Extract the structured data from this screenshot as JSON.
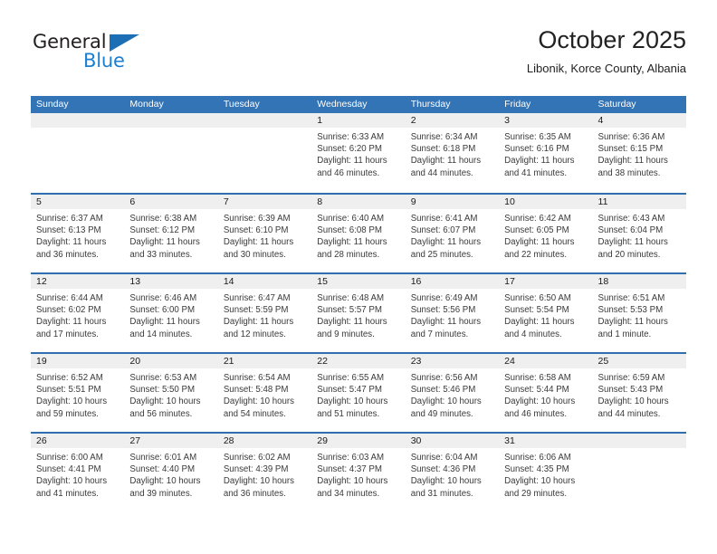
{
  "brand": {
    "name_top": "General",
    "name_bottom": "Blue",
    "triangle_color": "#1c6fb5",
    "blue_color": "#1c7fd0"
  },
  "header": {
    "title": "October 2025",
    "subtitle": "Libonik, Korce County, Albania"
  },
  "theme": {
    "header_blue": "#3274b6",
    "row_divider_blue": "#2f6fb0",
    "day_band_gray": "#efefef"
  },
  "weekdays": [
    "Sunday",
    "Monday",
    "Tuesday",
    "Wednesday",
    "Thursday",
    "Friday",
    "Saturday"
  ],
  "labels": {
    "sunrise": "Sunrise:",
    "sunset": "Sunset:",
    "daylight": "Daylight:"
  },
  "weeks": [
    [
      {
        "empty": true
      },
      {
        "empty": true
      },
      {
        "empty": true
      },
      {
        "day": "1",
        "sunrise": "Sunrise: 6:33 AM",
        "sunset": "Sunset: 6:20 PM",
        "daylight1": "Daylight: 11 hours",
        "daylight2": "and 46 minutes."
      },
      {
        "day": "2",
        "sunrise": "Sunrise: 6:34 AM",
        "sunset": "Sunset: 6:18 PM",
        "daylight1": "Daylight: 11 hours",
        "daylight2": "and 44 minutes."
      },
      {
        "day": "3",
        "sunrise": "Sunrise: 6:35 AM",
        "sunset": "Sunset: 6:16 PM",
        "daylight1": "Daylight: 11 hours",
        "daylight2": "and 41 minutes."
      },
      {
        "day": "4",
        "sunrise": "Sunrise: 6:36 AM",
        "sunset": "Sunset: 6:15 PM",
        "daylight1": "Daylight: 11 hours",
        "daylight2": "and 38 minutes."
      }
    ],
    [
      {
        "day": "5",
        "sunrise": "Sunrise: 6:37 AM",
        "sunset": "Sunset: 6:13 PM",
        "daylight1": "Daylight: 11 hours",
        "daylight2": "and 36 minutes."
      },
      {
        "day": "6",
        "sunrise": "Sunrise: 6:38 AM",
        "sunset": "Sunset: 6:12 PM",
        "daylight1": "Daylight: 11 hours",
        "daylight2": "and 33 minutes."
      },
      {
        "day": "7",
        "sunrise": "Sunrise: 6:39 AM",
        "sunset": "Sunset: 6:10 PM",
        "daylight1": "Daylight: 11 hours",
        "daylight2": "and 30 minutes."
      },
      {
        "day": "8",
        "sunrise": "Sunrise: 6:40 AM",
        "sunset": "Sunset: 6:08 PM",
        "daylight1": "Daylight: 11 hours",
        "daylight2": "and 28 minutes."
      },
      {
        "day": "9",
        "sunrise": "Sunrise: 6:41 AM",
        "sunset": "Sunset: 6:07 PM",
        "daylight1": "Daylight: 11 hours",
        "daylight2": "and 25 minutes."
      },
      {
        "day": "10",
        "sunrise": "Sunrise: 6:42 AM",
        "sunset": "Sunset: 6:05 PM",
        "daylight1": "Daylight: 11 hours",
        "daylight2": "and 22 minutes."
      },
      {
        "day": "11",
        "sunrise": "Sunrise: 6:43 AM",
        "sunset": "Sunset: 6:04 PM",
        "daylight1": "Daylight: 11 hours",
        "daylight2": "and 20 minutes."
      }
    ],
    [
      {
        "day": "12",
        "sunrise": "Sunrise: 6:44 AM",
        "sunset": "Sunset: 6:02 PM",
        "daylight1": "Daylight: 11 hours",
        "daylight2": "and 17 minutes."
      },
      {
        "day": "13",
        "sunrise": "Sunrise: 6:46 AM",
        "sunset": "Sunset: 6:00 PM",
        "daylight1": "Daylight: 11 hours",
        "daylight2": "and 14 minutes."
      },
      {
        "day": "14",
        "sunrise": "Sunrise: 6:47 AM",
        "sunset": "Sunset: 5:59 PM",
        "daylight1": "Daylight: 11 hours",
        "daylight2": "and 12 minutes."
      },
      {
        "day": "15",
        "sunrise": "Sunrise: 6:48 AM",
        "sunset": "Sunset: 5:57 PM",
        "daylight1": "Daylight: 11 hours",
        "daylight2": "and 9 minutes."
      },
      {
        "day": "16",
        "sunrise": "Sunrise: 6:49 AM",
        "sunset": "Sunset: 5:56 PM",
        "daylight1": "Daylight: 11 hours",
        "daylight2": "and 7 minutes."
      },
      {
        "day": "17",
        "sunrise": "Sunrise: 6:50 AM",
        "sunset": "Sunset: 5:54 PM",
        "daylight1": "Daylight: 11 hours",
        "daylight2": "and 4 minutes."
      },
      {
        "day": "18",
        "sunrise": "Sunrise: 6:51 AM",
        "sunset": "Sunset: 5:53 PM",
        "daylight1": "Daylight: 11 hours",
        "daylight2": "and 1 minute."
      }
    ],
    [
      {
        "day": "19",
        "sunrise": "Sunrise: 6:52 AM",
        "sunset": "Sunset: 5:51 PM",
        "daylight1": "Daylight: 10 hours",
        "daylight2": "and 59 minutes."
      },
      {
        "day": "20",
        "sunrise": "Sunrise: 6:53 AM",
        "sunset": "Sunset: 5:50 PM",
        "daylight1": "Daylight: 10 hours",
        "daylight2": "and 56 minutes."
      },
      {
        "day": "21",
        "sunrise": "Sunrise: 6:54 AM",
        "sunset": "Sunset: 5:48 PM",
        "daylight1": "Daylight: 10 hours",
        "daylight2": "and 54 minutes."
      },
      {
        "day": "22",
        "sunrise": "Sunrise: 6:55 AM",
        "sunset": "Sunset: 5:47 PM",
        "daylight1": "Daylight: 10 hours",
        "daylight2": "and 51 minutes."
      },
      {
        "day": "23",
        "sunrise": "Sunrise: 6:56 AM",
        "sunset": "Sunset: 5:46 PM",
        "daylight1": "Daylight: 10 hours",
        "daylight2": "and 49 minutes."
      },
      {
        "day": "24",
        "sunrise": "Sunrise: 6:58 AM",
        "sunset": "Sunset: 5:44 PM",
        "daylight1": "Daylight: 10 hours",
        "daylight2": "and 46 minutes."
      },
      {
        "day": "25",
        "sunrise": "Sunrise: 6:59 AM",
        "sunset": "Sunset: 5:43 PM",
        "daylight1": "Daylight: 10 hours",
        "daylight2": "and 44 minutes."
      }
    ],
    [
      {
        "day": "26",
        "sunrise": "Sunrise: 6:00 AM",
        "sunset": "Sunset: 4:41 PM",
        "daylight1": "Daylight: 10 hours",
        "daylight2": "and 41 minutes."
      },
      {
        "day": "27",
        "sunrise": "Sunrise: 6:01 AM",
        "sunset": "Sunset: 4:40 PM",
        "daylight1": "Daylight: 10 hours",
        "daylight2": "and 39 minutes."
      },
      {
        "day": "28",
        "sunrise": "Sunrise: 6:02 AM",
        "sunset": "Sunset: 4:39 PM",
        "daylight1": "Daylight: 10 hours",
        "daylight2": "and 36 minutes."
      },
      {
        "day": "29",
        "sunrise": "Sunrise: 6:03 AM",
        "sunset": "Sunset: 4:37 PM",
        "daylight1": "Daylight: 10 hours",
        "daylight2": "and 34 minutes."
      },
      {
        "day": "30",
        "sunrise": "Sunrise: 6:04 AM",
        "sunset": "Sunset: 4:36 PM",
        "daylight1": "Daylight: 10 hours",
        "daylight2": "and 31 minutes."
      },
      {
        "day": "31",
        "sunrise": "Sunrise: 6:06 AM",
        "sunset": "Sunset: 4:35 PM",
        "daylight1": "Daylight: 10 hours",
        "daylight2": "and 29 minutes."
      },
      {
        "empty": true
      }
    ]
  ]
}
